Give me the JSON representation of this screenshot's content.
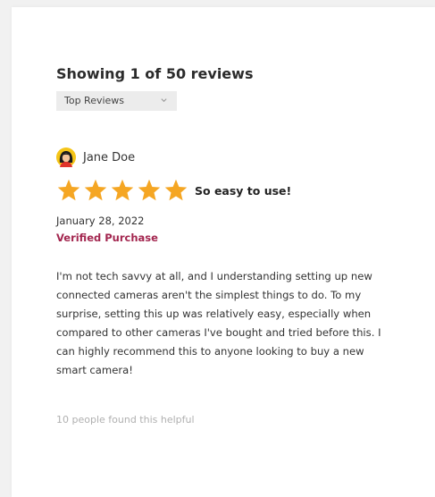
{
  "reviews_header": {
    "title": "Showing 1 of 50 reviews",
    "sort": {
      "selected": "Top Reviews",
      "icon": "chevron-down-icon"
    }
  },
  "review": {
    "reviewer_name": "Jane Doe",
    "avatar_icon": "user-avatar",
    "rating": 5,
    "rating_max": 5,
    "star_color": "#f5a623",
    "title": "So easy to use!",
    "date": "January 28, 2022",
    "verified_label": "Verified Purchase",
    "verified_color": "#a3264f",
    "body": "I'm not tech savvy at all, and I understanding setting up new connected cameras aren't the simplest things to do. To my surprise, setting this up was relatively easy, especially when compared to other cameras I've bought and tried before this. I can highly recommend this to anyone looking to buy a new smart camera!",
    "helpful_text": "10 people found this helpful"
  }
}
